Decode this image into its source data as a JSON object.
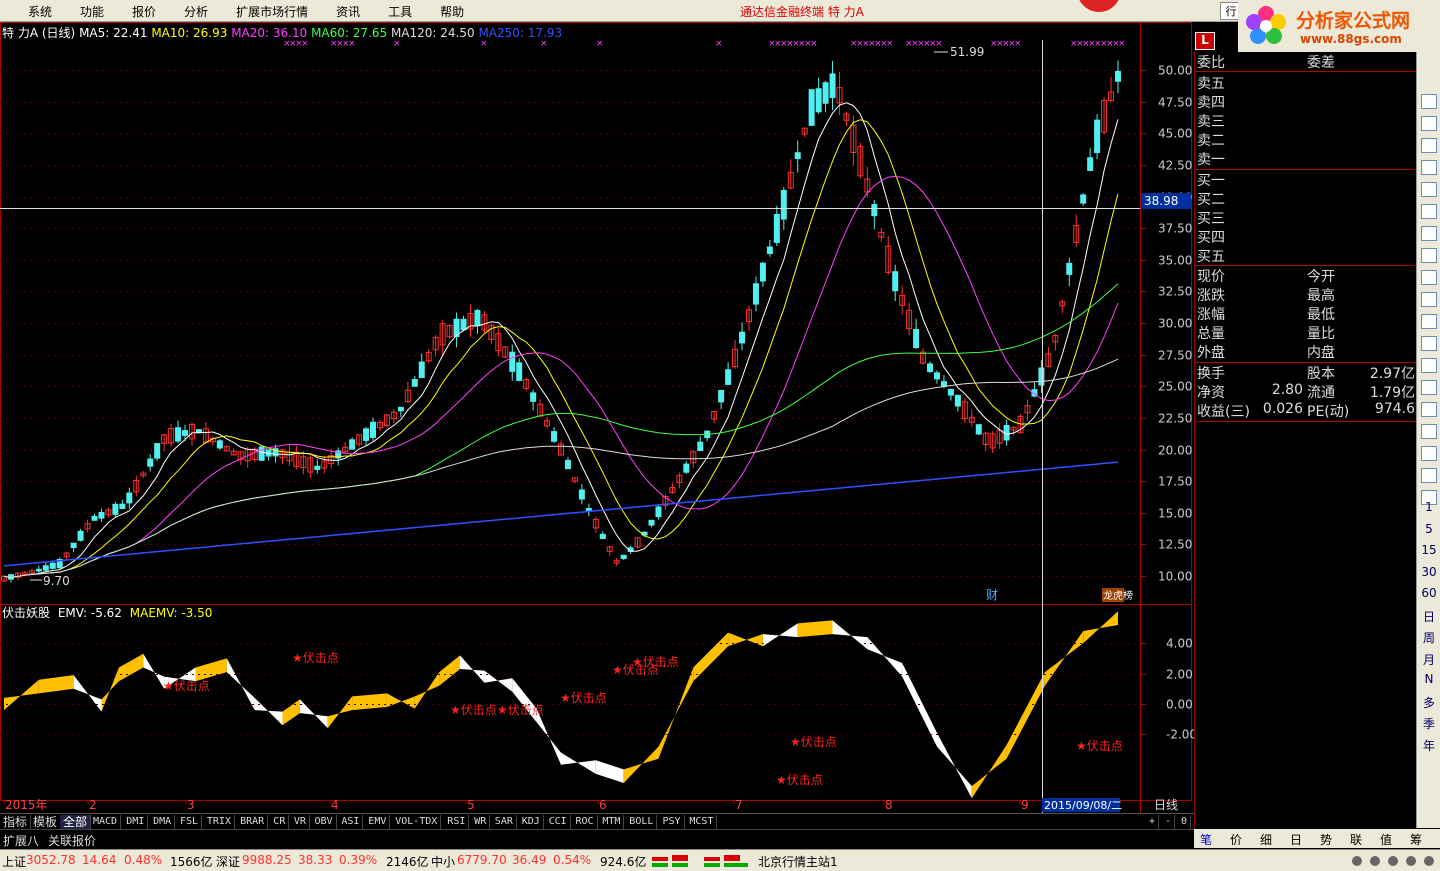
{
  "menubar": {
    "items": [
      "系统",
      "功能",
      "报价",
      "分析",
      "扩展市场行情",
      "资讯",
      "工具",
      "帮助"
    ],
    "title": "通达信金融终端   特   力A",
    "hang_label": "行"
  },
  "logo": {
    "text": "分析家公式网",
    "url": "www.88gs.com"
  },
  "main_chart": {
    "stock_name": "特  力A",
    "period": "(日线)",
    "ma": [
      {
        "label": "MA5: 22.41",
        "color": "#ffffff"
      },
      {
        "label": "MA10: 26.93",
        "color": "#ffff00"
      },
      {
        "label": "MA20: 36.10",
        "color": "#ff40ff"
      },
      {
        "label": "MA60: 27.65",
        "color": "#40ff40"
      },
      {
        "label": "MA120: 24.50",
        "color": "#dddddd"
      },
      {
        "label": "MA250: 17.93",
        "color": "#3050ff"
      }
    ],
    "price_axis": [
      "50.00",
      "47.50",
      "45.00",
      "42.50",
      "40.00",
      "37.50",
      "35.00",
      "32.50",
      "30.00",
      "27.50",
      "25.00",
      "22.50",
      "20.00",
      "17.50",
      "15.00",
      "12.50",
      "10.00"
    ],
    "crosshair_price": "38.98",
    "high_label": "51.99",
    "low_label": "9.70",
    "fin_marker": "财",
    "bang_marker": "龙虎榜"
  },
  "indicator": {
    "name": "伏击妖股",
    "emv": "EMV: -5.62",
    "maemv": "MAEMV: -3.50",
    "axis": [
      "4.00",
      "2.00",
      "0.00",
      "-2.00"
    ],
    "signal_label": "伏击点"
  },
  "x_axis": {
    "labels": [
      "2015年",
      "2",
      "3",
      "4",
      "5",
      "6",
      "7",
      "8",
      "9"
    ],
    "cursor_date": "2015/09/08/二",
    "period_button": "日线"
  },
  "tabs": [
    "指标",
    "模板",
    "全部",
    "MACD",
    "DMI",
    "DMA",
    "FSL",
    "TRIX",
    "BRAR",
    "CR",
    "VR",
    "OBV",
    "ASI",
    "EMV",
    "VOL-TDX",
    "RSI",
    "WR",
    "SAR",
    "KDJ",
    "CCI",
    "ROC",
    "MTM",
    "BOLL",
    "PSY",
    "MCST"
  ],
  "tab_controls": [
    "+",
    "-",
    "0"
  ],
  "subtabs": [
    "扩展八",
    "关联报价"
  ],
  "quote": {
    "header": {
      "l": "委比",
      "m": "委差"
    },
    "asks": [
      "卖五",
      "卖四",
      "卖三",
      "卖二",
      "卖一"
    ],
    "bids": [
      "买一",
      "买二",
      "买三",
      "买四",
      "买五"
    ],
    "rows1": [
      {
        "l": "现价",
        "m": "今开"
      },
      {
        "l": "涨跌",
        "m": "最高"
      },
      {
        "l": "涨幅",
        "m": "最低"
      },
      {
        "l": "总量",
        "m": "量比"
      },
      {
        "l": "外盘",
        "m": "内盘"
      }
    ],
    "rows2": [
      {
        "l": "换手",
        "m": "股本",
        "v2": "2.97亿"
      },
      {
        "l": "净资",
        "v1": "2.80",
        "m": "流通",
        "v2": "1.79亿"
      },
      {
        "l": "收益(三)",
        "v1": "0.026",
        "m": "PE(动)",
        "v2": "974.6"
      }
    ]
  },
  "right_toolbar": {
    "periods": [
      "1",
      "5",
      "15",
      "30",
      "60",
      "日",
      "周",
      "月",
      "N",
      "多",
      "季",
      "年"
    ],
    "logo_letter": "L"
  },
  "bottom_tabs": [
    "笔",
    "价",
    "细",
    "日",
    "势",
    "联",
    "值",
    "筹"
  ],
  "status": {
    "sh_label": "上证",
    "sh_price": "3052.78",
    "sh_chg": "14.64",
    "sh_pct": "0.48%",
    "sh_amt": "1566亿",
    "sz_label": "深证",
    "sz_price": "9988.25",
    "sz_chg": "38.33",
    "sz_pct": "0.39%",
    "sz_amt": "2146亿",
    "zx_label": "中小",
    "zx_price": "6779.70",
    "zx_chg": "36.49",
    "zx_pct": "0.54%",
    "zx_amt": "924.6亿",
    "server": "北京行情主站1"
  }
}
